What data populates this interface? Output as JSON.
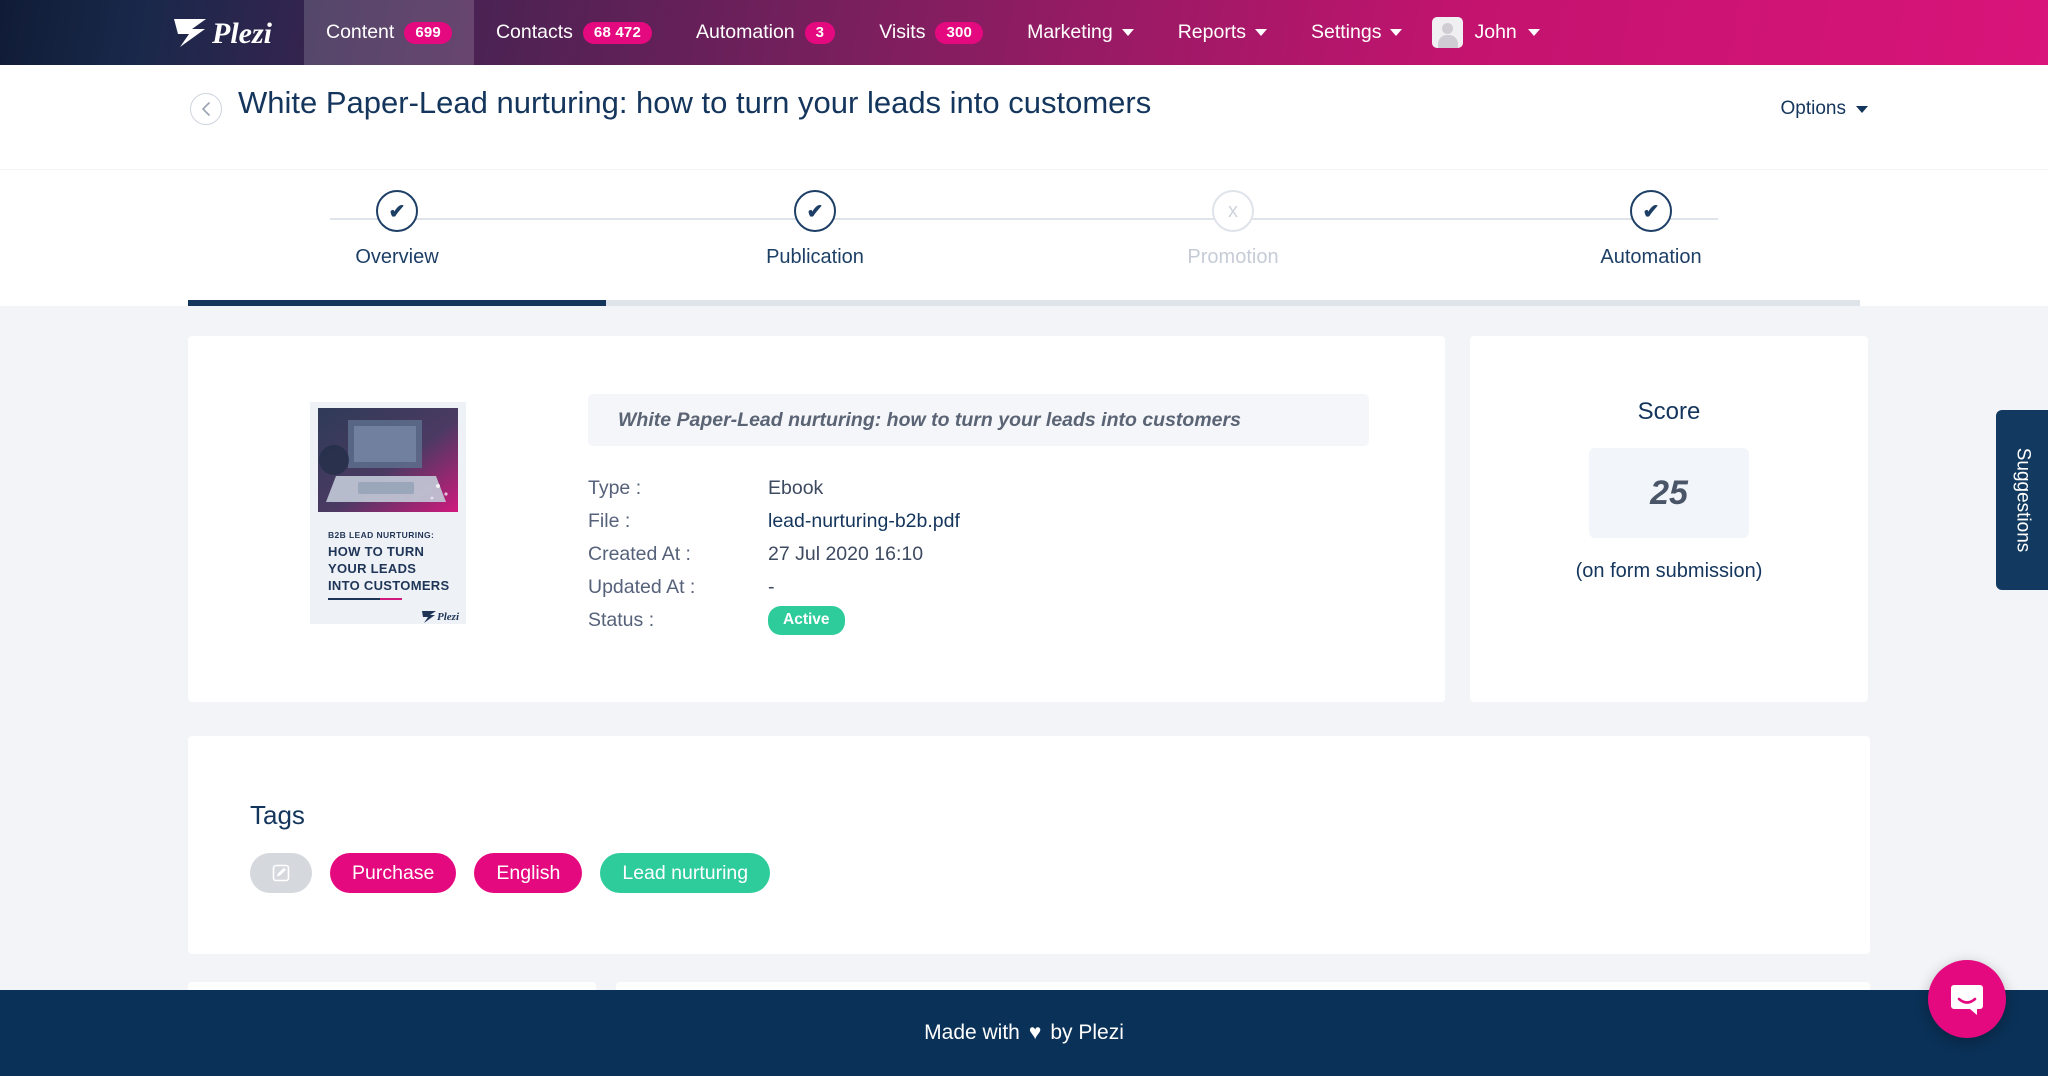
{
  "nav": {
    "logo_text": "Plezi",
    "items": [
      {
        "label": "Content",
        "badge": "699",
        "active": true
      },
      {
        "label": "Contacts",
        "badge": "68 472",
        "active": false
      },
      {
        "label": "Automation",
        "badge": "3",
        "active": false
      },
      {
        "label": "Visits",
        "badge": "300",
        "active": false
      }
    ],
    "menus": [
      "Marketing",
      "Reports",
      "Settings"
    ],
    "user": "John"
  },
  "header": {
    "title": "White Paper-Lead nurturing: how to turn your leads into customers",
    "options_label": "Options",
    "back_icon": "chevron-left-icon"
  },
  "stepper": {
    "steps": [
      {
        "label": "Overview",
        "mark": "✔",
        "state": "done",
        "current": true
      },
      {
        "label": "Publication",
        "mark": "✔",
        "state": "done",
        "current": false
      },
      {
        "label": "Promotion",
        "mark": "x",
        "state": "todo",
        "current": false
      },
      {
        "label": "Automation",
        "mark": "✔",
        "state": "done",
        "current": false
      }
    ]
  },
  "overview": {
    "subject": "White Paper-Lead nurturing: how to turn your leads into customers",
    "cover": {
      "kicker": "B2B LEAD NURTURING:",
      "line1": "HOW TO TURN",
      "line2": "YOUR LEADS",
      "line3": "INTO CUSTOMERS",
      "brand": "Plezi"
    },
    "rows": [
      {
        "label": "Type :",
        "value": "Ebook",
        "kind": "text"
      },
      {
        "label": "File :",
        "value": "lead-nurturing-b2b.pdf",
        "kind": "link"
      },
      {
        "label": "Created At :",
        "value": "27 Jul 2020 16:10",
        "kind": "text"
      },
      {
        "label": "Updated At :",
        "value": "-",
        "kind": "text"
      },
      {
        "label": "Status :",
        "value": "Active",
        "kind": "badge"
      }
    ]
  },
  "score": {
    "title": "Score",
    "value": "25",
    "note": "(on form submission)"
  },
  "tags": {
    "title": "Tags",
    "edit_icon": "pencil-square-icon",
    "items": [
      {
        "label": "Purchase",
        "color": "pink"
      },
      {
        "label": "English",
        "color": "pink"
      },
      {
        "label": "Lead nurturing",
        "color": "green"
      }
    ]
  },
  "suggestions": {
    "label": "Suggestions"
  },
  "footer": {
    "prefix": "Made with",
    "heart": "♥",
    "suffix": "by Plezi"
  },
  "chat": {
    "icon": "chat-bubble-icon"
  },
  "colors": {
    "brand_pink": "#e5097f",
    "navy": "#14355c",
    "green": "#2ecc9b",
    "footer": "#0a3157",
    "page_bg": "#f2f4f7"
  }
}
